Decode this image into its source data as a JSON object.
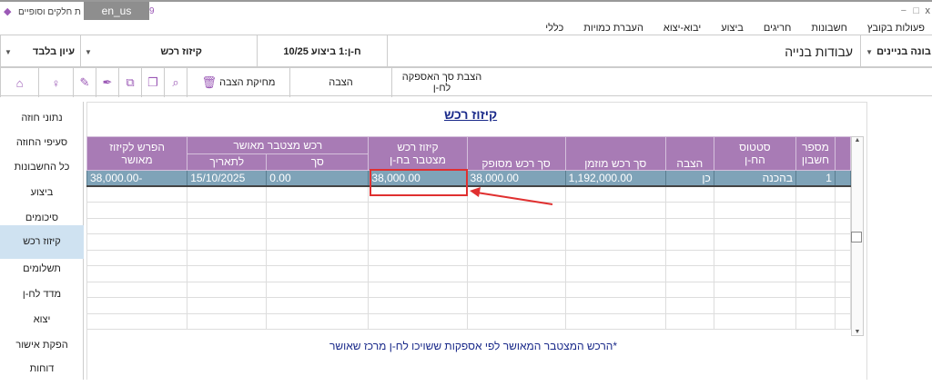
{
  "titlebar": {
    "app_title": "ת חלקים וסופיים",
    "lang": "en_us",
    "num": "9",
    "window_controls": [
      "−",
      "□",
      "x"
    ]
  },
  "menu": [
    "פעולות בקובץ",
    "חשבונות",
    "חריגים",
    "ביצוע",
    "יבוא-יצוא",
    "העברת כמויות",
    "כללי"
  ],
  "selectors": {
    "company": "בונה בניינים",
    "project": "עבודות בנייה",
    "period": "ח-ן:1 ביצוע 10/25",
    "screen": "קיזוז רכש",
    "mode": "עיון בלבד"
  },
  "toolbar": {
    "show_supply": "הצבת סך האספקה לח-ן",
    "place": "הצבה",
    "delete_place": "מחיקת הצבה"
  },
  "sidebar": [
    "נתוני חוזה",
    "סעיפי החוזה",
    "כל החשבונות",
    "ביצוע",
    "סיכומים",
    "קיזוז רכש",
    "תשלומים",
    "מדד לח-ן",
    "יצוא",
    "הפקת אישור",
    "דוחות"
  ],
  "page_title": "קיזוז רכש",
  "table": {
    "headers": {
      "account_1": "מספר",
      "account_2": "חשבון",
      "status_1": "סטטוס",
      "status_2": "הח-ן",
      "placed": "הצבה",
      "ordered": "סך רכש מוזמן",
      "supplied": "סך רכש מסופק",
      "offset_1": "קיזוז רכש",
      "offset_2": "מצטבר בח-ן",
      "approved_group": "רכש מצטבר מאושר",
      "approved_sum": "סך",
      "approved_date": "לתאריך",
      "diff_1": "הפרש לקיזוז",
      "diff_2": "מאושר"
    },
    "row": {
      "account": "1",
      "status": "בהכנה",
      "placed": "כן",
      "ordered": "1,192,000.00",
      "supplied": "38,000.00",
      "offset": "38,000.00",
      "approved_sum": "0.00",
      "approved_date": "15/10/2025",
      "diff": "-38,000.00"
    }
  },
  "footnote": "*הרכש המצטבר המאושר לפי אספקות ששויכו לח-ן מרכז שאושר",
  "colors": {
    "header": "#a87bb5",
    "row": "#7fa3b8",
    "highlight": "#e03030",
    "selected": "#cfe2f1"
  }
}
